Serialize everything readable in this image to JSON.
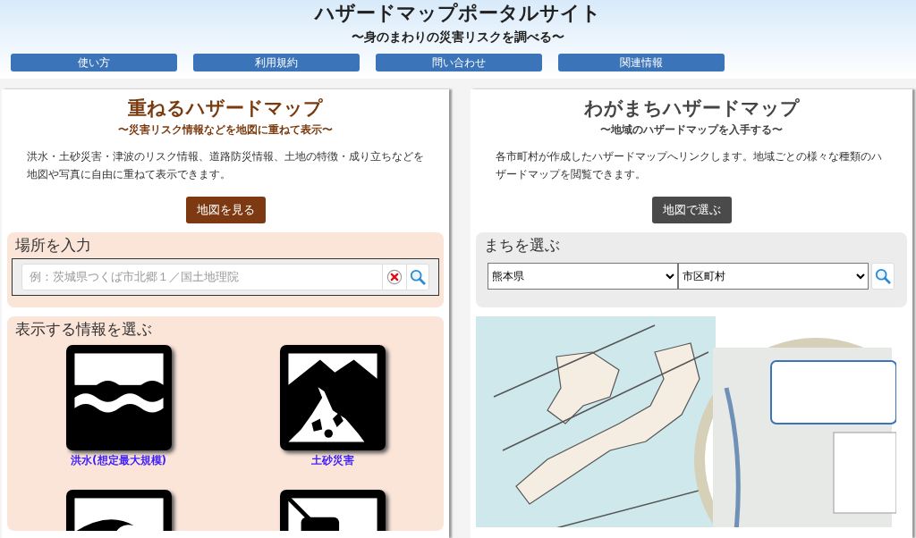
{
  "header": {
    "title": "ハザードマップポータルサイト",
    "subtitle": "〜身のまわりの災害リスクを調べる〜"
  },
  "nav": [
    "使い方",
    "利用規約",
    "問い合わせ",
    "関連情報"
  ],
  "overlay_panel": {
    "title": "重ねるハザードマップ",
    "subtitle": "〜災害リスク情報などを地図に重ねて表示〜",
    "description": "洪水・土砂災害・津波のリスク情報、道路防災情報、土地の特徴・成り立ちなどを地図や写真に自由に重ねて表示できます。",
    "button": "地図を見る",
    "place_search": {
      "heading": "場所を入力",
      "placeholder": "例：茨城県つくば市北郷１／国土地理院"
    },
    "info_select": {
      "heading": "表示する情報を選ぶ",
      "items": [
        {
          "kind": "flood",
          "label": "洪水(想定最大規模)"
        },
        {
          "kind": "landslide",
          "label": "土砂災害"
        },
        {
          "kind": "tsunami"
        },
        {
          "kind": "road"
        }
      ]
    }
  },
  "local_panel": {
    "title": "わがまちハザードマップ",
    "subtitle": "〜地域のハザードマップを入手する〜",
    "description": "各市町村が作成したハザードマップへリンクします。地域ごとの様々な種類のハザードマップを閲覧できます。",
    "button": "地図で選ぶ",
    "town_select": {
      "heading": "まちを選ぶ",
      "prefecture": "熊本県",
      "municipality": "市区町村"
    }
  }
}
